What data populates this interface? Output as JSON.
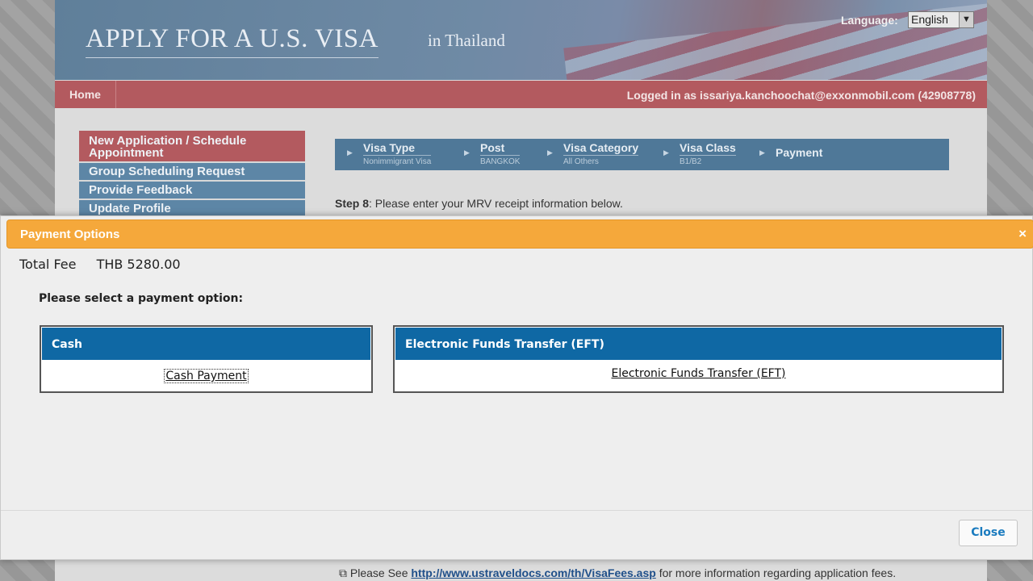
{
  "banner": {
    "title": "APPLY FOR A U.S. VISA",
    "subtitle": "in Thailand",
    "language_label": "Language:",
    "language_value": "English"
  },
  "nav": {
    "home": "Home",
    "logged_in": "Logged in as  issariya.kanchoochat@exxonmobil.com (42908778)"
  },
  "sidebar": {
    "items": [
      {
        "label": "New Application / Schedule Appointment"
      },
      {
        "label": "Group Scheduling Request"
      },
      {
        "label": "Provide Feedback"
      },
      {
        "label": "Update Profile"
      }
    ]
  },
  "progress": {
    "steps": [
      {
        "name": "Visa Type",
        "value": "Nonimmigrant Visa"
      },
      {
        "name": "Post",
        "value": "BANGKOK"
      },
      {
        "name": "Visa Category",
        "value": "All Others"
      },
      {
        "name": "Visa Class",
        "value": "B1/B2"
      },
      {
        "name": "Payment",
        "value": ""
      }
    ]
  },
  "step_text": {
    "label": "Step 8",
    "text": ": Please enter your MRV receipt information below."
  },
  "footer": {
    "prefix": "Please See",
    "link": "http://www.ustraveldocs.com/th/VisaFees.asp",
    "suffix": "for more information regarding application fees."
  },
  "modal": {
    "title": "Payment Options",
    "close_x": "×",
    "fee_label": "Total Fee",
    "fee_value": "THB 5280.00",
    "prompt": "Please select a payment option:",
    "options": [
      {
        "header": "Cash",
        "link": "Cash Payment"
      },
      {
        "header": "Electronic Funds Transfer (EFT)",
        "link": "Electronic Funds Transfer (EFT)"
      }
    ],
    "close_button": "Close"
  },
  "colors": {
    "modal_header": "#f5a83b",
    "option_header": "#0f68a4",
    "nav_red": "#b35a5f",
    "nav_blue": "#5d86a6"
  }
}
